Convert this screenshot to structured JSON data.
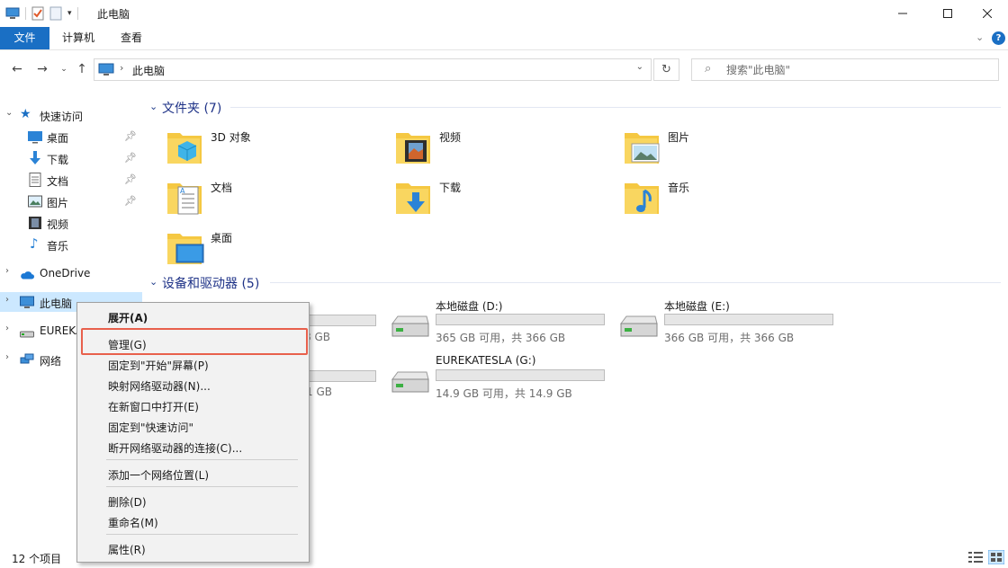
{
  "window": {
    "title": "此电脑",
    "controls": [
      "minimize",
      "maximize",
      "close"
    ]
  },
  "ribbon": {
    "tabs": [
      {
        "label": "文件",
        "active": true
      },
      {
        "label": "计算机"
      },
      {
        "label": "查看"
      }
    ]
  },
  "address": {
    "path": "此电脑",
    "search_placeholder": "搜索\"此电脑\""
  },
  "sidebar": {
    "quick_access": "快速访问",
    "quick_items": [
      {
        "label": "桌面",
        "icon": "desktop-icon",
        "pinned": true
      },
      {
        "label": "下载",
        "icon": "download-icon",
        "pinned": true
      },
      {
        "label": "文档",
        "icon": "document-icon",
        "pinned": true
      },
      {
        "label": "图片",
        "icon": "picture-icon",
        "pinned": true
      },
      {
        "label": "视频",
        "icon": "video-icon",
        "pinned": false
      },
      {
        "label": "音乐",
        "icon": "music-icon",
        "pinned": false
      }
    ],
    "onedrive": "OneDrive",
    "this_pc": "此电脑",
    "eureka": "EUREKA",
    "network": "网络"
  },
  "content": {
    "folders_title": "文件夹 (7)",
    "folders": [
      "3D 对象",
      "视频",
      "图片",
      "文档",
      "下载",
      "音乐",
      "桌面"
    ],
    "devices_title": "设备和驱动器 (5)",
    "drives": [
      {
        "name": "本地磁盘 (D:)",
        "free": "365 GB 可用，共 366 GB",
        "used_fraction": 0.0
      },
      {
        "name": "本地磁盘 (E:)",
        "free": "366 GB 可用，共 366 GB",
        "used_fraction": 0.0
      },
      {
        "name": "EUREKATESLA (G:)",
        "free": "14.9 GB 可用，共 14.9 GB",
        "used_fraction": 0.0
      }
    ],
    "partial_free_1": "8 GB",
    "partial_free_2": "1 GB"
  },
  "context_menu": {
    "items": [
      "展开(A)",
      "管理(G)",
      "固定到\"开始\"屏幕(P)",
      "映射网络驱动器(N)...",
      "在新窗口中打开(E)",
      "固定到\"快速访问\"",
      "断开网络驱动器的连接(C)...",
      "添加一个网络位置(L)",
      "删除(D)",
      "重命名(M)",
      "属性(R)"
    ]
  },
  "status": {
    "count": "12 个项目"
  },
  "colors": {
    "accent": "#1a6fc4",
    "selected_bg": "#cce8ff",
    "highlight_border": "#e8604c",
    "folder_yellow": "#f5c842"
  }
}
